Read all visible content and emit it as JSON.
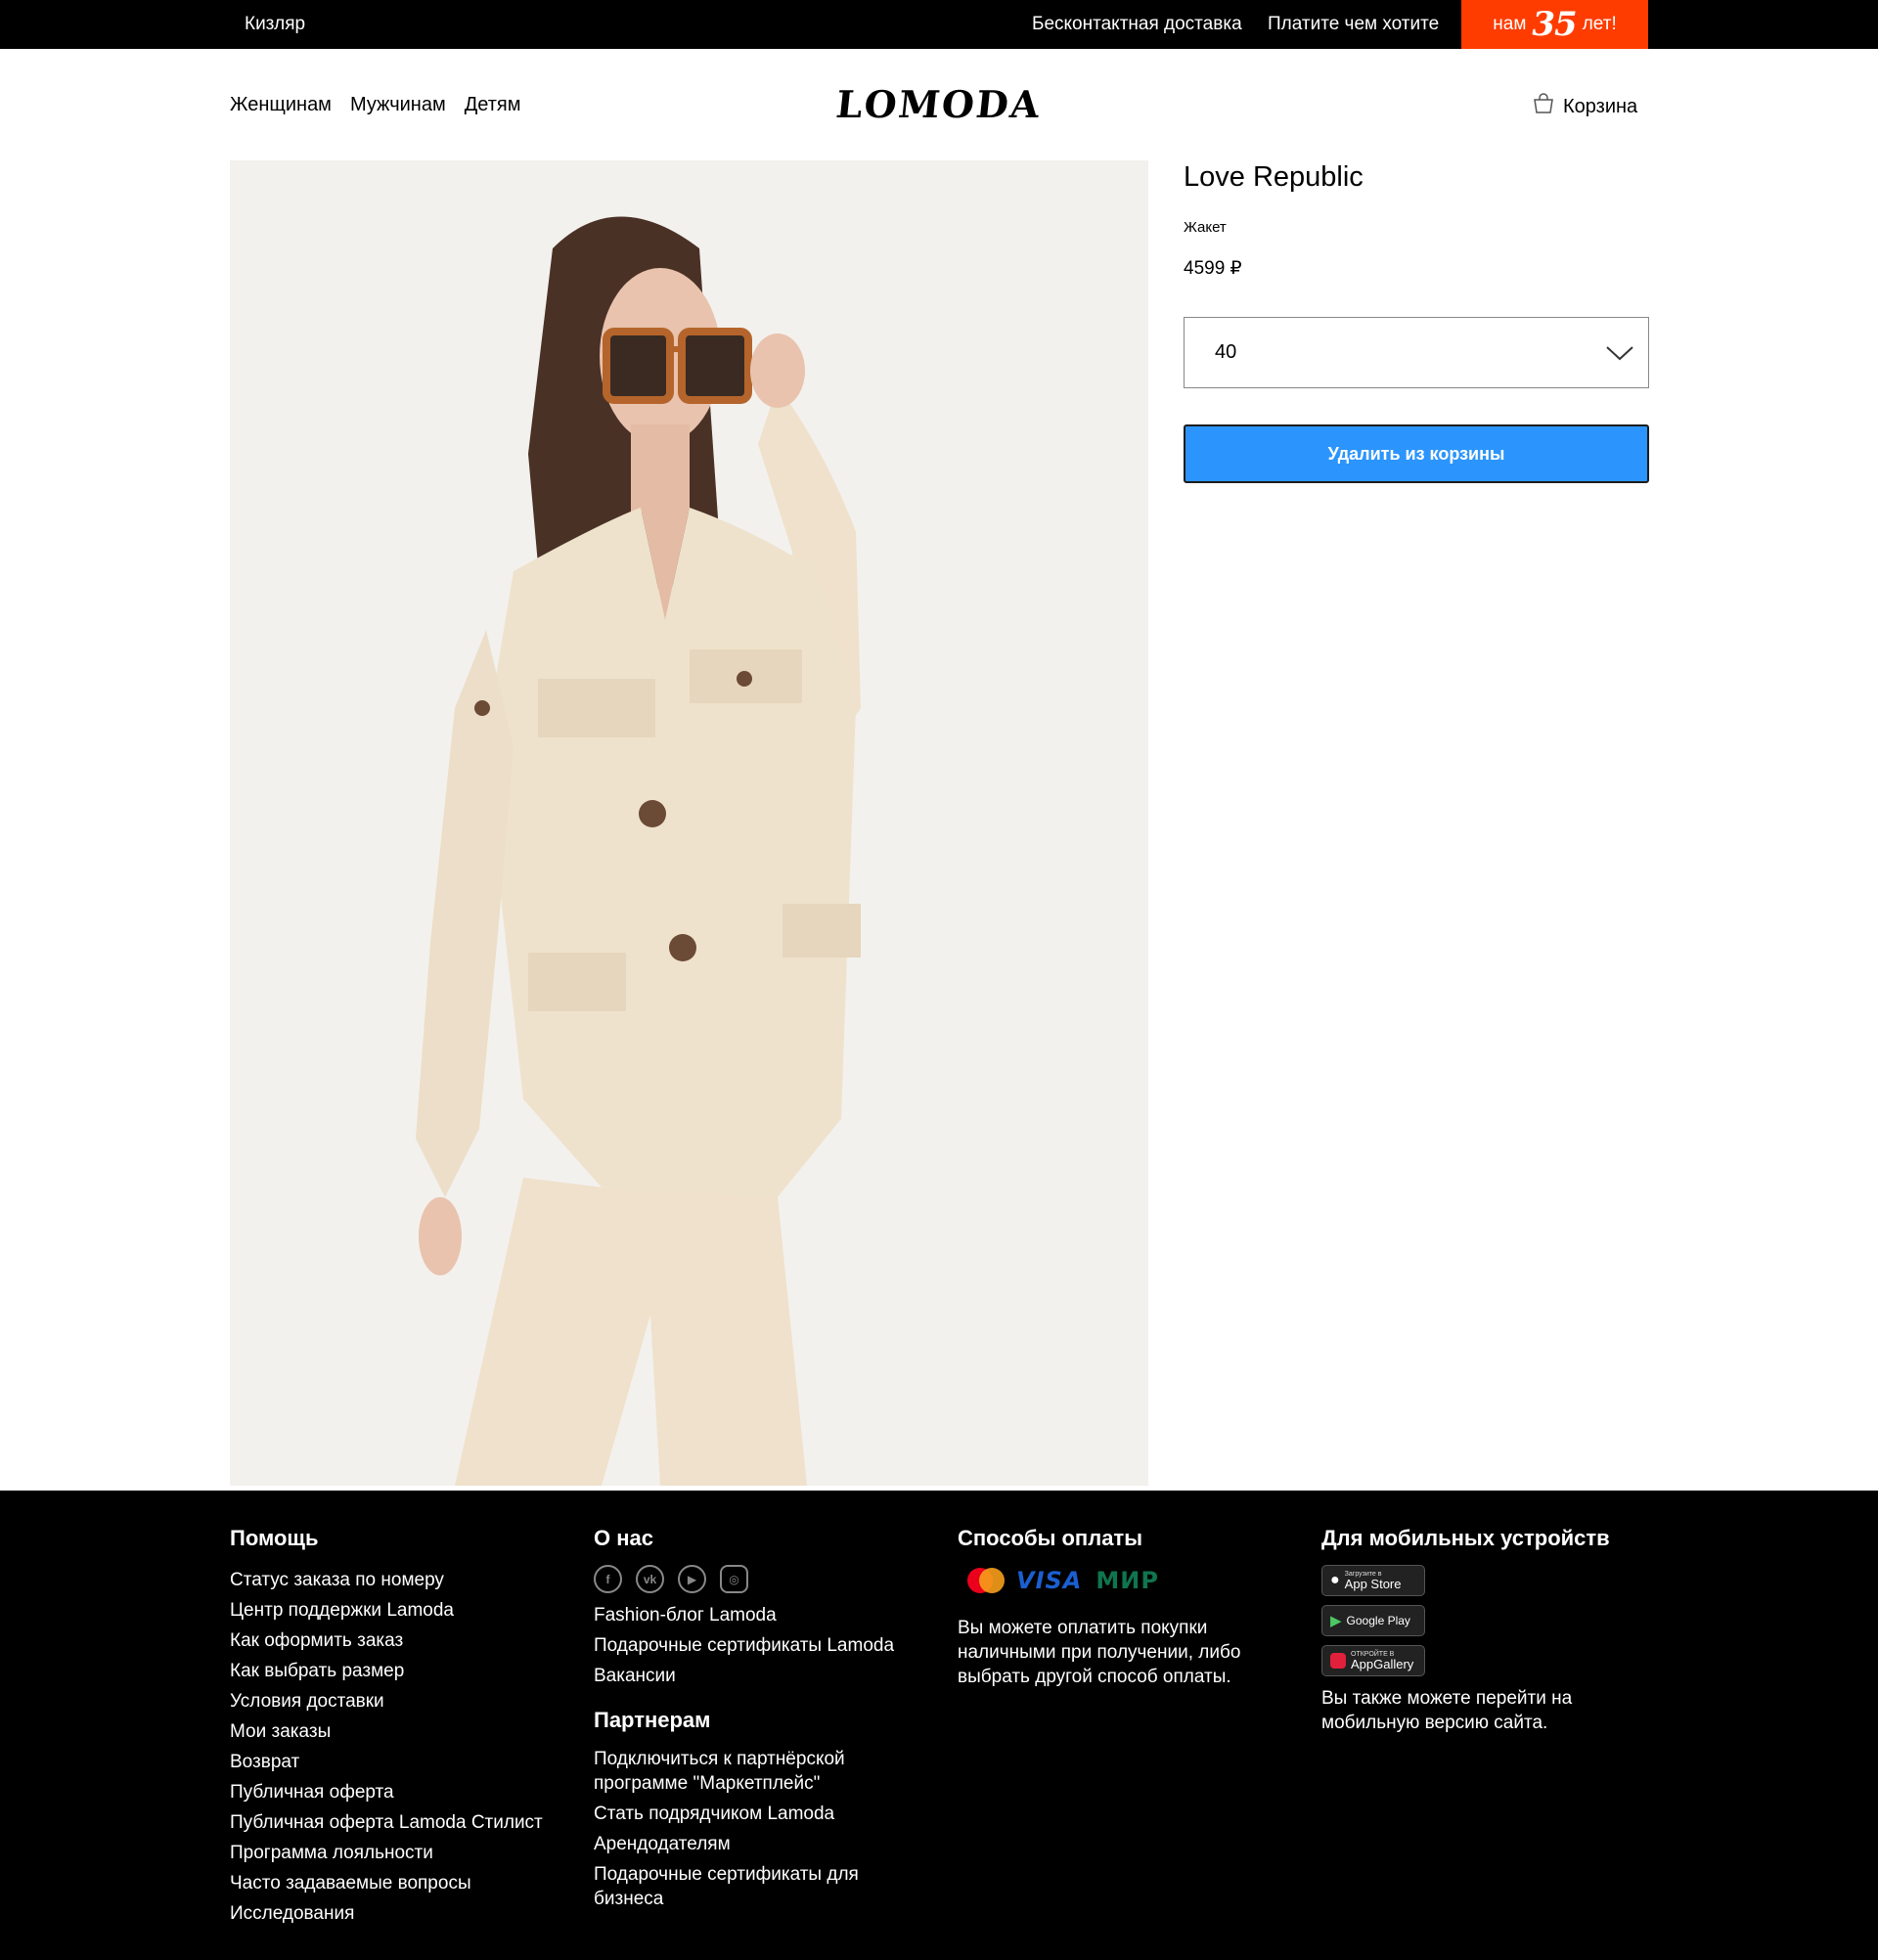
{
  "topbar": {
    "city": "Кизляр",
    "delivery": "Бесконтактная доставка",
    "pay": "Платите чем хотите",
    "anniversary_pre": "нам",
    "anniversary_num": "35",
    "anniversary_post": "лет!",
    "accent_color": "#ff3c00"
  },
  "header": {
    "nav": [
      "Женщинам",
      "Мужчинам",
      "Детям"
    ],
    "logo": "LOMODA",
    "cart_label": "Корзина",
    "cart_icon": "bag-icon"
  },
  "product": {
    "brand": "Love Republic",
    "type": "Жакет",
    "price": "4599 ₽",
    "size_selected": "40",
    "remove_button": "Удалить из корзины",
    "button_color": "#2b95fd"
  },
  "footer": {
    "help": {
      "title": "Помощь",
      "links": [
        "Статус заказа по номеру",
        "Центр поддержки Lamoda",
        "Как оформить заказ",
        "Как выбрать размер",
        "Условия доставки",
        "Мои заказы",
        "Возврат",
        "Публичная оферта",
        "Публичная оферта Lamoda Стилист",
        "Программа лояльности",
        "Часто задаваемые вопросы",
        "Исследования"
      ]
    },
    "about": {
      "title": "О нас",
      "socials": [
        "facebook-icon",
        "vk-icon",
        "youtube-icon",
        "instagram-icon"
      ],
      "links": [
        "Fashion-блог Lamoda",
        "Подарочные сертификаты Lamoda",
        "Вакансии"
      ]
    },
    "partners": {
      "title": "Партнерам",
      "links": [
        "Подключиться к партнёрской программе \"Маркетплейс\"",
        "Стать подрядчиком Lamoda",
        "Арендодателям",
        "Подарочные сертификаты для бизнеса"
      ]
    },
    "payment": {
      "title": "Способы оплаты",
      "logos": [
        "mastercard",
        "VISA",
        "МИР"
      ],
      "visa": "VISA",
      "mir": "МИР",
      "text": "Вы можете оплатить покупки наличными при получении, либо выбрать другой способ оплаты."
    },
    "mobile": {
      "title": "Для мобильных устройств",
      "stores": [
        {
          "small": "Загрузите в",
          "big": "App Store"
        },
        {
          "small": "",
          "big": "Google Play"
        },
        {
          "small": "ОТКРОЙТЕ В",
          "big": "AppGallery"
        }
      ],
      "text": "Вы также можете перейти на мобильную версию сайта."
    }
  }
}
